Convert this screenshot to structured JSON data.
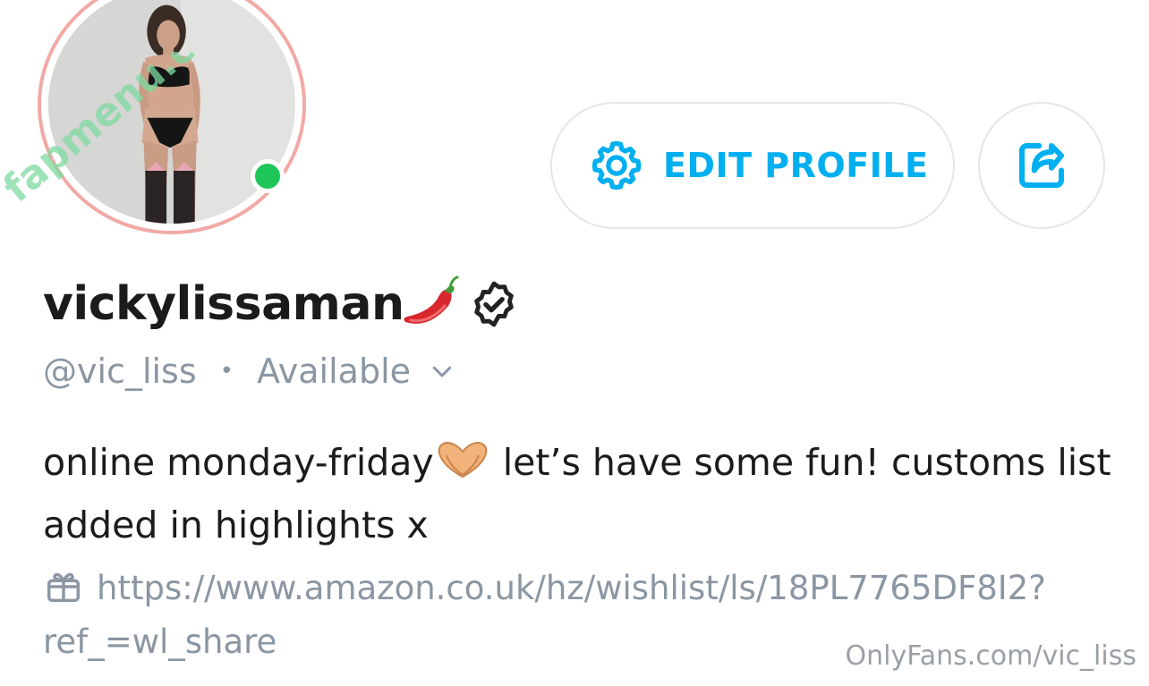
{
  "profile": {
    "display_name": "vickylissaman",
    "name_emoji": "chili-pepper",
    "handle": "@vic_liss",
    "separator": "•",
    "status": "Available",
    "online": true,
    "bio_part1": "online monday-friday",
    "bio_emoji": "heart-hands",
    "bio_part2": " let’s have some fun! customs list added in highlights x",
    "link_url": "https://www.amazon.co.uk/hz/wishlist/ls/18PL7765DF8I2?ref_=wl_share"
  },
  "actions": {
    "edit_label": "EDIT PROFILE",
    "edit_icon": "gear-icon",
    "share_icon": "share-icon"
  },
  "watermark": {
    "avatar_overlay": "fapmenu.com",
    "footer": "OnlyFans.com/vic_liss"
  },
  "colors": {
    "accent": "#00aff0",
    "muted": "#8a96a3",
    "online": "#1ec65a",
    "avatar_ring": "#f2a9a5",
    "overlay_green": "#7ed9a0"
  }
}
